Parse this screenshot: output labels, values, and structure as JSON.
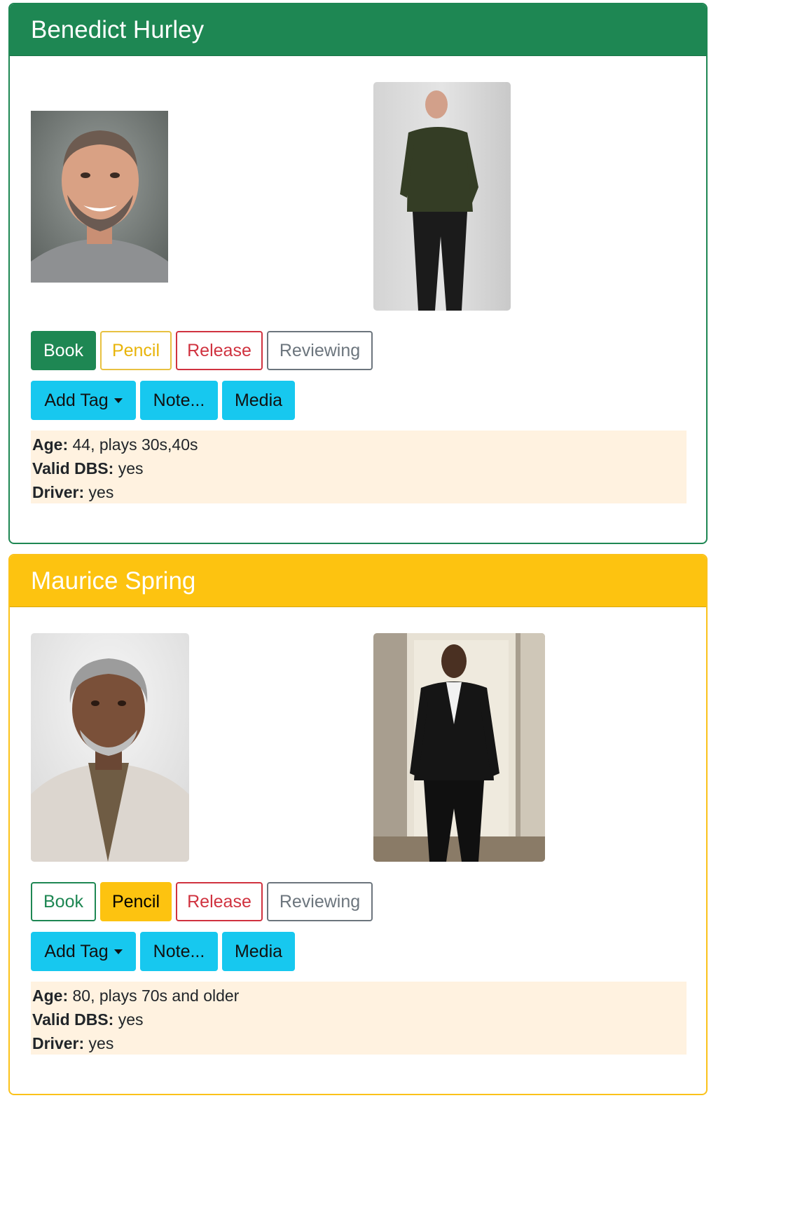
{
  "cards": [
    {
      "name": "Benedict Hurley",
      "headshot": "headshot-photo",
      "fullbody": "full-body-photo",
      "status": "Book",
      "buttons": {
        "book": "Book",
        "pencil": "Pencil",
        "release": "Release",
        "reviewing": "Reviewing",
        "add_tag": "Add Tag",
        "note": "Note...",
        "media": "Media"
      },
      "info": {
        "age_label": "Age:",
        "age_value": "44, plays 30s,40s",
        "dbs_label": "Valid DBS:",
        "dbs_value": "yes",
        "driver_label": "Driver:",
        "driver_value": "yes"
      }
    },
    {
      "name": "Maurice Spring",
      "headshot": "headshot-photo",
      "fullbody": "full-body-photo",
      "status": "Pencil",
      "buttons": {
        "book": "Book",
        "pencil": "Pencil",
        "release": "Release",
        "reviewing": "Reviewing",
        "add_tag": "Add Tag",
        "note": "Note...",
        "media": "Media"
      },
      "info": {
        "age_label": "Age:",
        "age_value": "80, plays 70s and older",
        "dbs_label": "Valid DBS:",
        "dbs_value": "yes",
        "driver_label": "Driver:",
        "driver_value": "yes"
      }
    }
  ],
  "colors": {
    "success": "#1e8753",
    "warning": "#fdc310",
    "danger": "#d0323f",
    "secondary": "#6c757d",
    "info": "#17c8ef",
    "info_panel": "#fff2e0"
  }
}
